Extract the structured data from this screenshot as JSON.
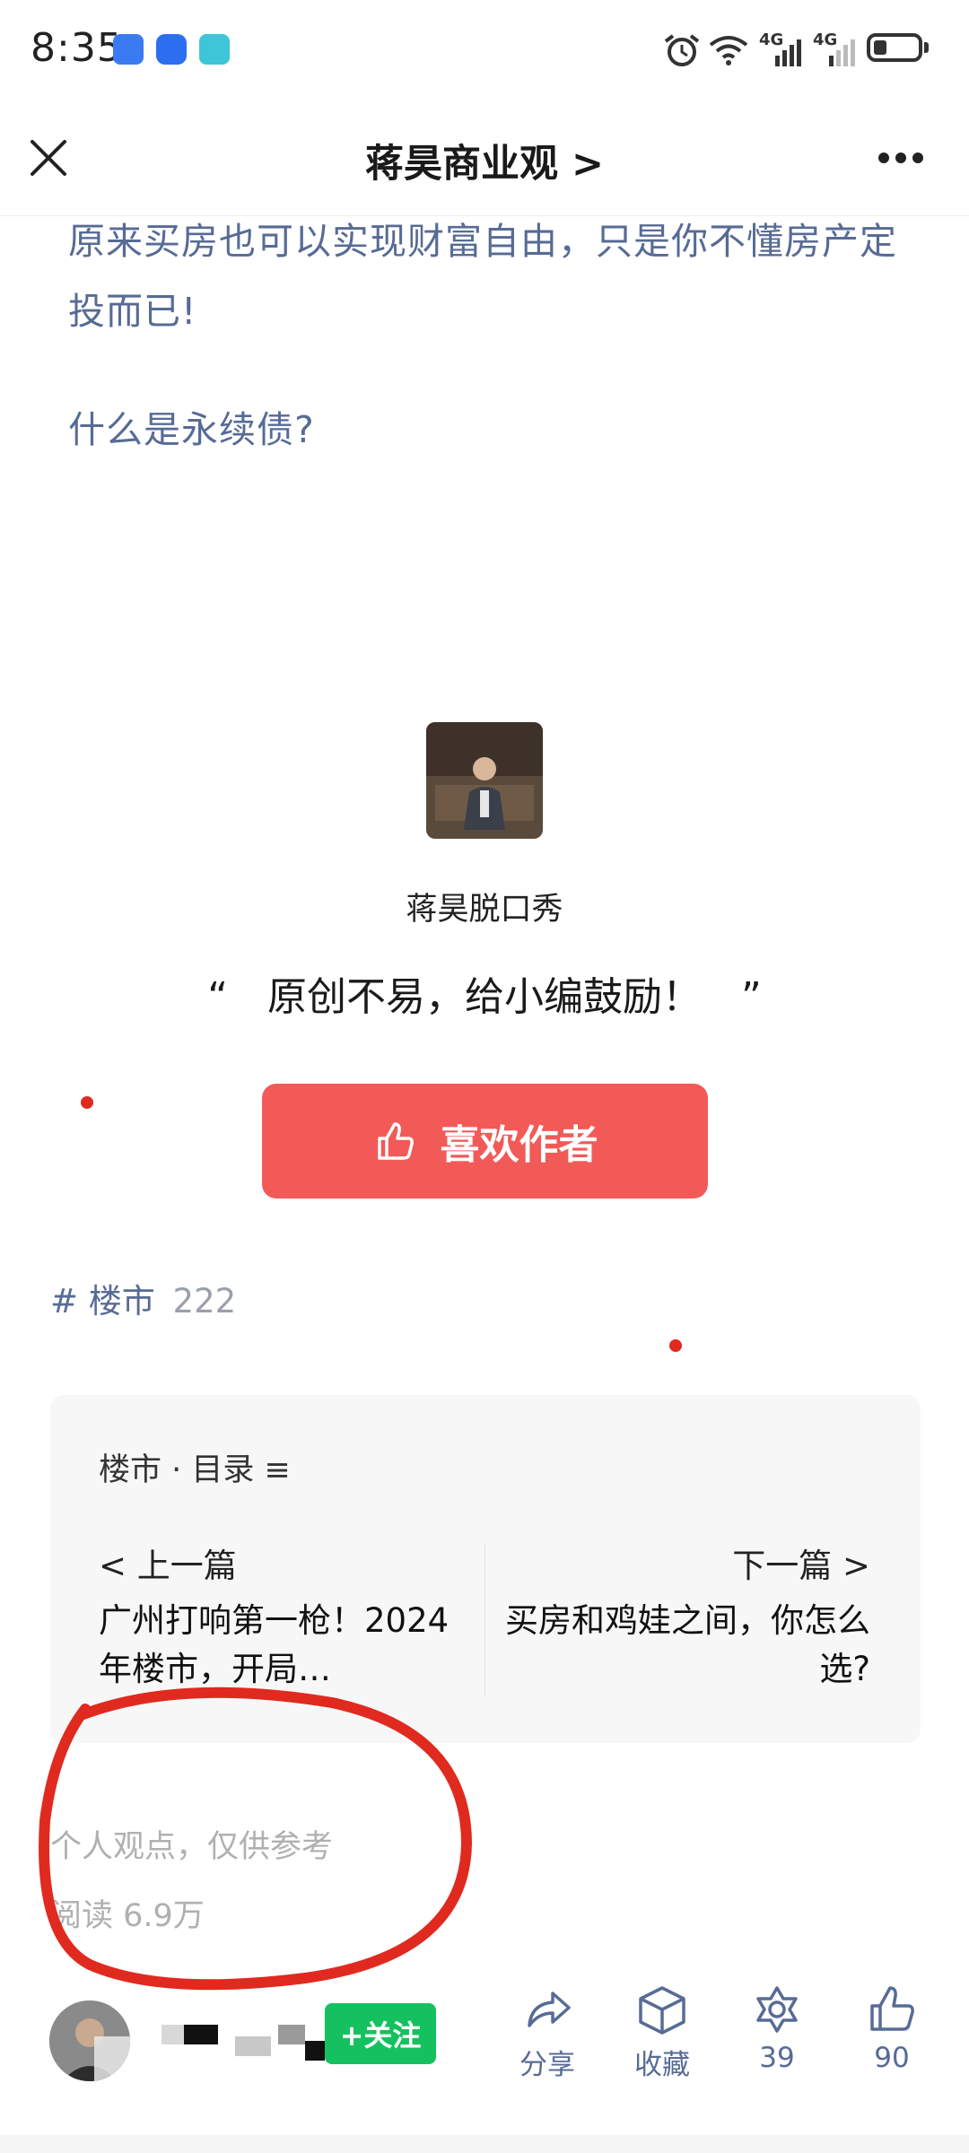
{
  "status_bar": {
    "time": "8:35",
    "signal1": "4G",
    "signal2": "4G"
  },
  "nav": {
    "title": "蒋昊商业观 >"
  },
  "article": {
    "paragraph1": "原来买房也可以实现财富自由，只是你不懂房产定投而已!",
    "paragraph2": "什么是永续债?"
  },
  "author_card": {
    "name": "蒋昊脱口秀",
    "encourage": "“　原创不易，给小编鼓励！　”",
    "like_button": "喜欢作者"
  },
  "tag": {
    "label": "# 楼市",
    "count": "222"
  },
  "toc": {
    "title": "楼市 · 目录 ≡",
    "prev_label": "< 上一篇",
    "prev_title": "广州打响第一枪！2024年楼市，开局…",
    "next_label": "下一篇 >",
    "next_title": "买房和鸡娃之间，你怎么选?"
  },
  "footer": {
    "disclaimer": "个人观点，仅供参考",
    "reads": "阅读 6.9万"
  },
  "bottom_bar": {
    "follow": "+关注",
    "share": "分享",
    "collect": "收藏",
    "wow_count": "39",
    "like_count": "90"
  },
  "colors": {
    "link_blue": "#576b95",
    "like_red": "#f25a58",
    "follow_green": "#15c15e",
    "annotation_red": "#e02a1f"
  },
  "icons": [
    "close-icon",
    "more-icon",
    "thumb-icon",
    "share-icon",
    "collect-icon",
    "wow-icon",
    "like-icon"
  ]
}
